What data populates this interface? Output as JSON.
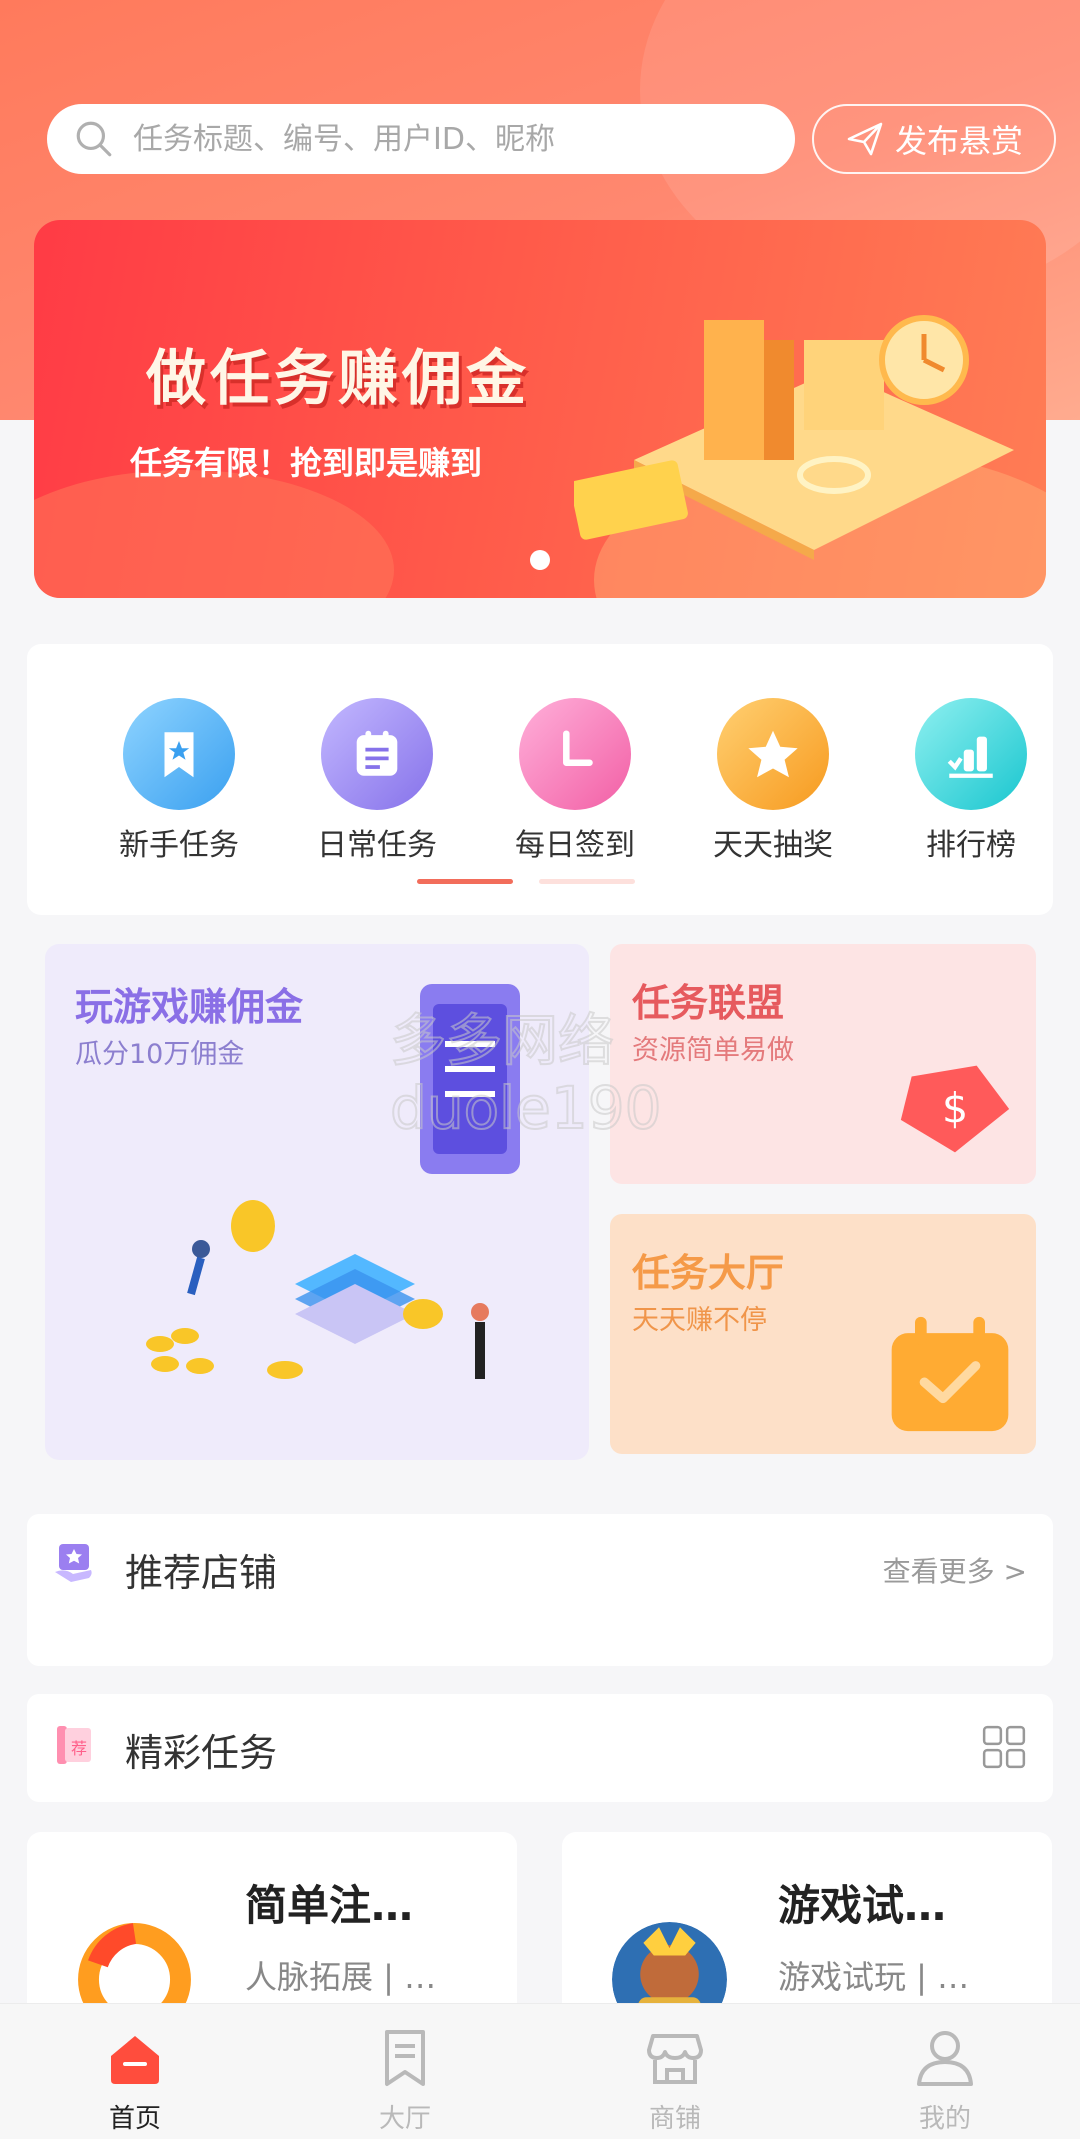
{
  "search": {
    "placeholder": "任务标题、编号、用户ID、昵称"
  },
  "header": {
    "post_button": "发布悬赏"
  },
  "banner": {
    "title": "做任务赚佣金",
    "subtitle": "任务有限！抢到即是赚到"
  },
  "quick_nav": [
    {
      "label": "新手任务",
      "icon": "bookmark-star-icon",
      "color": "#5ab6f5"
    },
    {
      "label": "日常任务",
      "icon": "list-card-icon",
      "color": "#9b8cf2"
    },
    {
      "label": "每日签到",
      "icon": "clock-icon",
      "color": "#f77fbb"
    },
    {
      "label": "天天抽奖",
      "icon": "star-icon",
      "color": "#fcae3d"
    },
    {
      "label": "排行榜",
      "icon": "bar-chart-icon",
      "color": "#3cd5d9"
    }
  ],
  "promos": {
    "games": {
      "title": "玩游戏赚佣金",
      "subtitle": "瓜分10万佣金"
    },
    "alliance": {
      "title": "任务联盟",
      "subtitle": "资源简单易做"
    },
    "hall": {
      "title": "任务大厅",
      "subtitle": "天天赚不停"
    }
  },
  "recommended_shops": {
    "title": "推荐店铺",
    "more": "查看更多 >"
  },
  "featured_tasks": {
    "title": "精彩任务",
    "items": [
      {
        "title": "简单注…",
        "tag": "人脉拓展 | …"
      },
      {
        "title": "游戏试…",
        "tag": "游戏试玩 | …"
      }
    ]
  },
  "tabbar": [
    {
      "label": "首页",
      "icon": "home-icon",
      "active": true
    },
    {
      "label": "大厅",
      "icon": "bookmark-icon",
      "active": false
    },
    {
      "label": "商铺",
      "icon": "store-icon",
      "active": false
    },
    {
      "label": "我的",
      "icon": "user-icon",
      "active": false
    }
  ],
  "colors": {
    "primary": "#ff5a4a",
    "price": "#ee2f2f"
  }
}
